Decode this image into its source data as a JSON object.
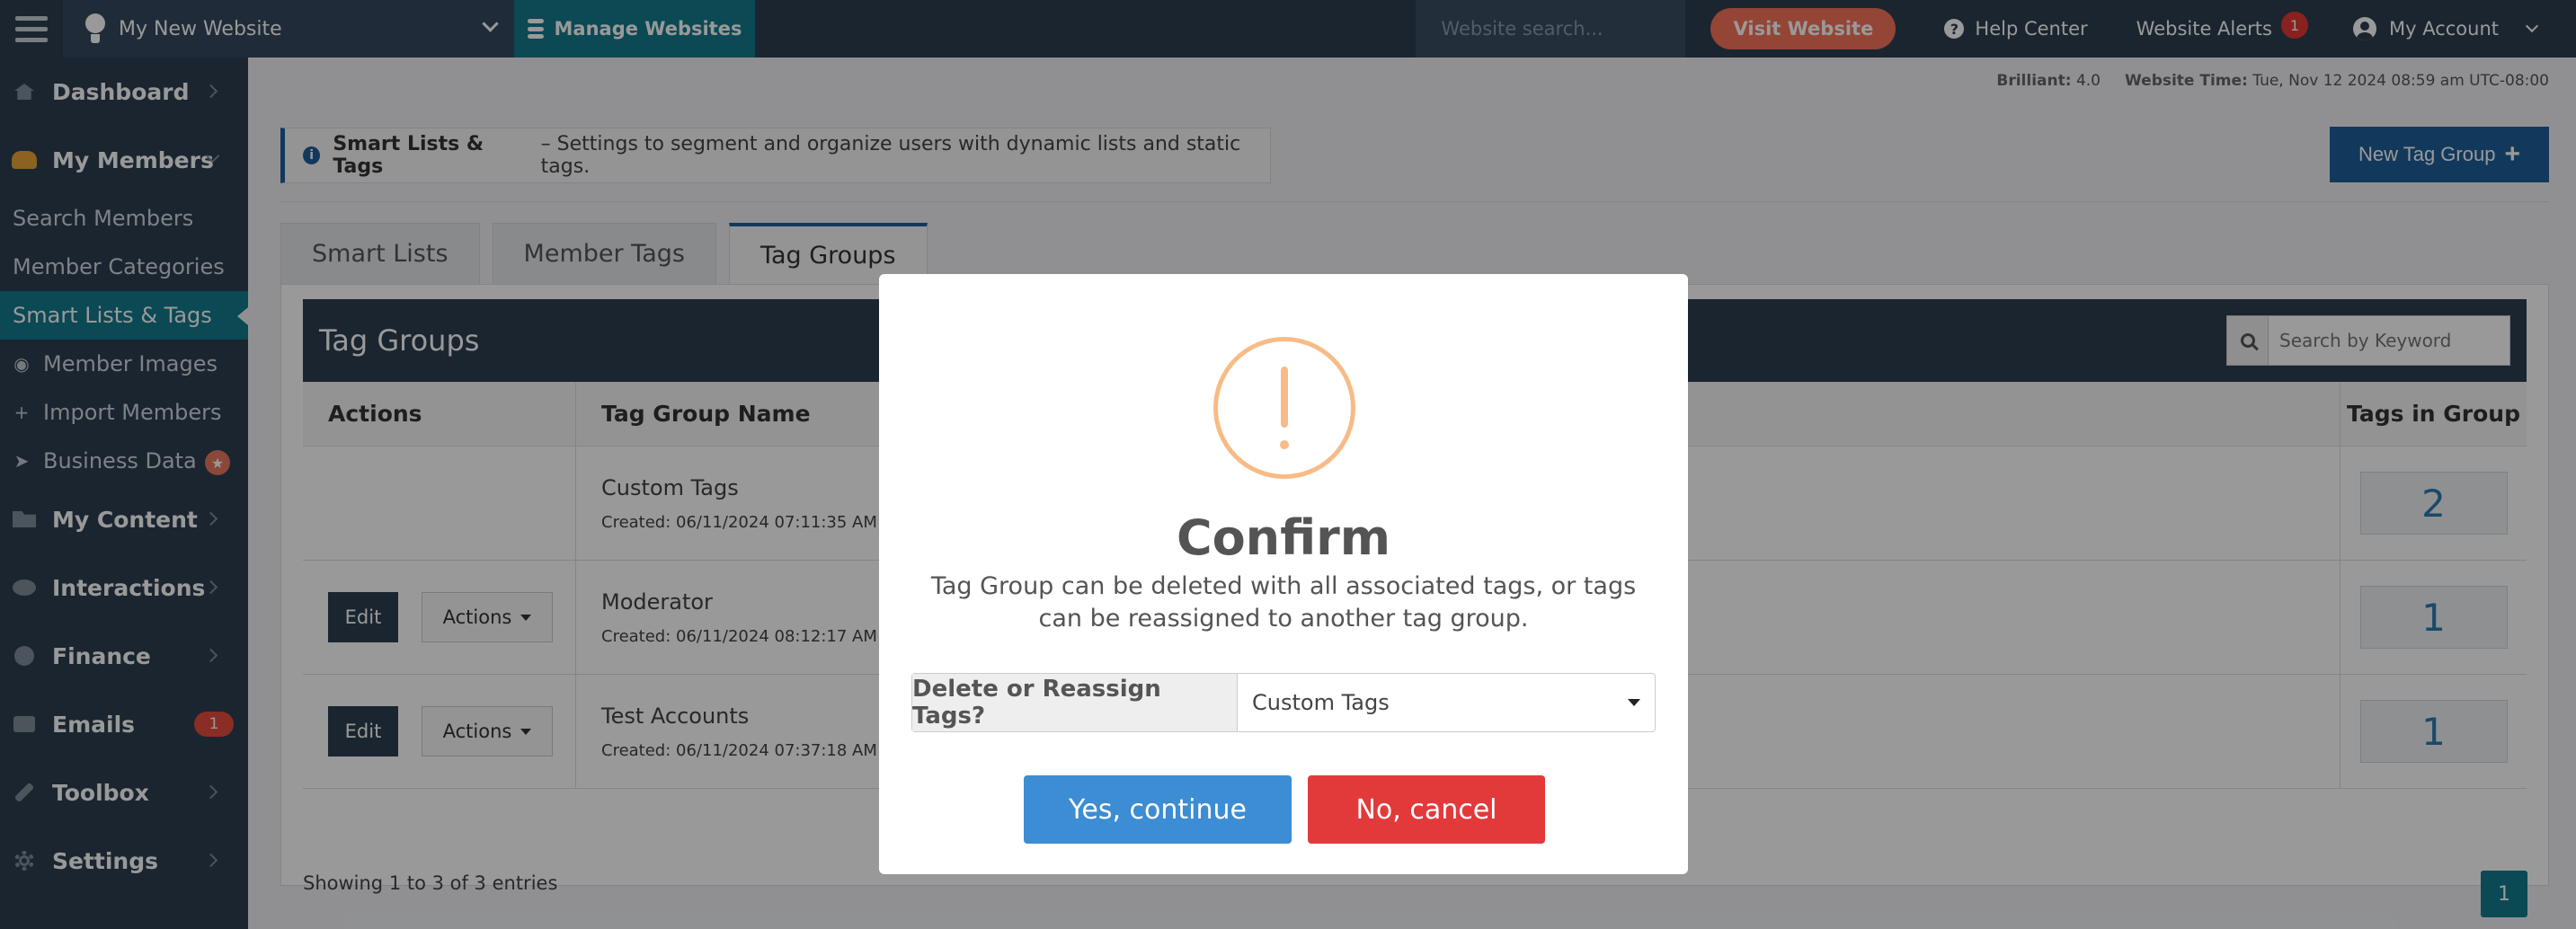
{
  "topbar": {
    "site_name": "My New Website",
    "manage_label": "Manage Websites",
    "search_placeholder": "Website search...",
    "visit_label": "Visit Website",
    "help_label": "Help Center",
    "alerts_label": "Website Alerts",
    "alerts_count": "1",
    "account_label": "My Account"
  },
  "sidebar": {
    "dashboard": "Dashboard",
    "members": "My Members",
    "members_sub": [
      "Search Members",
      "Member Categories",
      "Smart Lists & Tags",
      "Member Images",
      "Import Members",
      "Business Data"
    ],
    "content": "My Content",
    "interactions": "Interactions",
    "finance": "Finance",
    "emails": "Emails",
    "emails_count": "1",
    "toolbox": "Toolbox",
    "settings": "Settings"
  },
  "meta": {
    "brilliant_label": "Brilliant:",
    "brilliant_value": "4.0",
    "time_label": "Website Time:",
    "time_value": "Tue, Nov 12 2024 08:59 am UTC-08:00"
  },
  "info": {
    "title": "Smart Lists & Tags",
    "text": "– Settings to segment and organize users with dynamic lists and static tags."
  },
  "new_tag_group_label": "New Tag Group",
  "tabs": [
    "Smart Lists",
    "Member Tags",
    "Tag Groups"
  ],
  "panel": {
    "title": "Tag Groups",
    "search_placeholder": "Search by Keyword",
    "columns": [
      "Actions",
      "Tag Group Name",
      "Tags in Group"
    ],
    "rows": [
      {
        "name": "Custom Tags",
        "created": "Created: 06/11/2024 07:11:35 AM",
        "count": "2"
      },
      {
        "name": "Moderator",
        "created": "Created: 06/11/2024 08:12:17 AM",
        "count": "1"
      },
      {
        "name": "Test Accounts",
        "created": "Created: 06/11/2024 07:37:18 AM",
        "count": "1"
      }
    ],
    "edit_label": "Edit",
    "actions_label": "Actions",
    "showing": "Showing 1 to 3 of 3 entries",
    "page": "1"
  },
  "modal": {
    "title": "Confirm",
    "text": "Tag Group can be deleted with all associated tags, or tags can be reassigned to another tag group.",
    "field_label": "Delete or Reassign Tags?",
    "field_value": "Custom Tags",
    "yes_label": "Yes, continue",
    "no_label": "No, cancel"
  },
  "colors": {
    "nav_dark": "#2c3e50",
    "teal": "#137a8c",
    "primary_blue": "#1f5f99",
    "visit_orange": "#f7735a",
    "warn_orange": "#f8bb86",
    "confirm_blue": "#3c8dd3",
    "cancel_red": "#e23a3a"
  }
}
